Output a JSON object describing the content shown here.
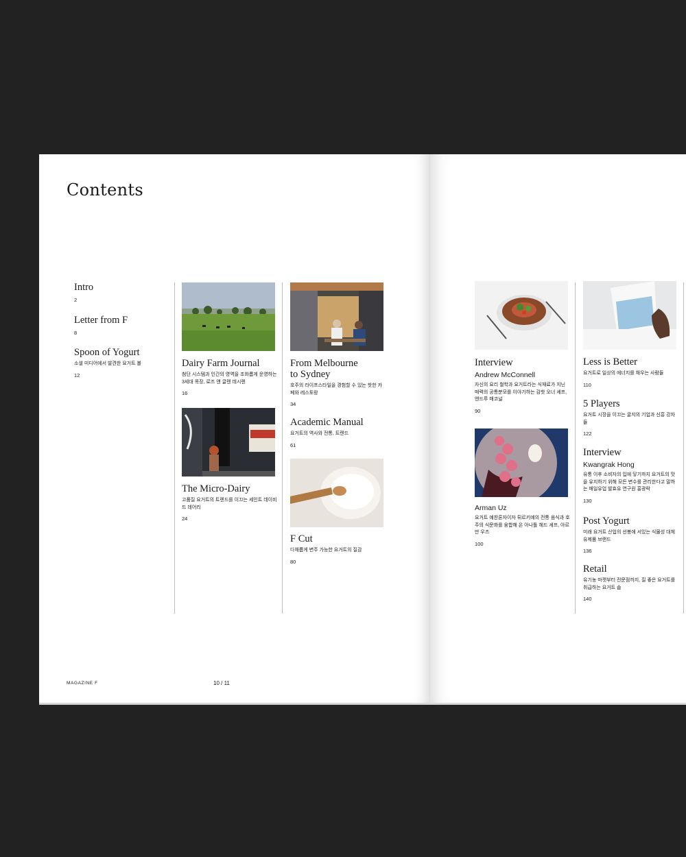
{
  "page": {
    "title": "Contents",
    "footer_brand": "MAGAZINE F",
    "page_indicator": "10 / 11"
  },
  "left_column": [
    {
      "title": "Intro",
      "page": "2"
    },
    {
      "title": "Letter from F",
      "page": "8"
    },
    {
      "title": "Spoon of Yogurt",
      "desc": "소셜 미디어에서 발견한 요거트 볼",
      "page": "12"
    }
  ],
  "column2": [
    {
      "title": "Dairy Farm Journal",
      "desc": "첨단 시스템과 인간의 영역을 조화롭게 운영하는 3세대 목장, 로즈 앤 글렌 데시렌",
      "page": "16",
      "image": "farm-landscape-photo"
    },
    {
      "title": "The Micro-Dairy",
      "desc": "고품질 요거트의 트렌드를 이끄는 세인트 데이비드 데어리",
      "page": "24",
      "image": "dairy-storefront-photo"
    }
  ],
  "column3": [
    {
      "title": "From Melbourne to Sydney",
      "title_line1": "From Melbourne",
      "title_line2": "to Sydney",
      "desc": "호주의 라이프스타일을 경험할 수 있는 핫한 카페와 레스토랑",
      "page": "34",
      "image": "cafe-street-photo"
    },
    {
      "title": "Academic Manual",
      "desc": "요거트의 역사와 전통, 트렌드",
      "page": "61"
    },
    {
      "title": "F Cut",
      "desc": "다채롭게 변주 가능한 요거트의 질감",
      "page": "80",
      "image": "yogurt-spoon-photo"
    }
  ],
  "column4": [
    {
      "title": "Interview",
      "subtitle": "Andrew McConnell",
      "desc": "자신의 요리 철학과 요거트라는 식재료가 지닌 매력의 공통분모를 이야기하는 감핫 오너 셰프, 앤드루 매코널",
      "page": "90",
      "image": "plated-dish-photo"
    },
    {
      "subtitle": "Arman Uz",
      "desc": "요거트 예찬론자이자 튀르키예의 전통 음식과 호주의 식문화를 융합해 온 아나톨 헤드 셰프, 아르만 우즈",
      "page": "100",
      "image": "radish-dish-photo"
    }
  ],
  "column5": [
    {
      "title": "Less is Better",
      "desc": "요거트로 일상의 에너지를 채우는 사람들",
      "page": "110",
      "image": "yogurt-cup-photo"
    },
    {
      "title": "5 Players",
      "desc": "요거트 시장을 이끄는 굴지의 기업과 신흥 강자들",
      "page": "122"
    },
    {
      "title": "Interview",
      "subtitle": "Kwangrak Hong",
      "desc": "유통 이후 소비자의 입에 닿기까지 요거트의 맛을 유지하기 위해 모든 변수를 관리한다고 말하는 매일유업 발효유 연구원 홍광락",
      "page": "130"
    },
    {
      "title": "Post Yogurt",
      "desc": "미래 요거트 산업의 선봉에 서있는 식물성 대체 유제품 브랜드",
      "page": "136"
    },
    {
      "title": "Retail",
      "desc": "유기농 마켓부터 전문점까지, 질 좋은 요거트를 취급하는 요거트 숍",
      "page": "140"
    }
  ],
  "colors": {
    "background": "#222222",
    "paper": "#ffffff",
    "rule": "#bdbdbd",
    "text": "#1a1a1a"
  }
}
